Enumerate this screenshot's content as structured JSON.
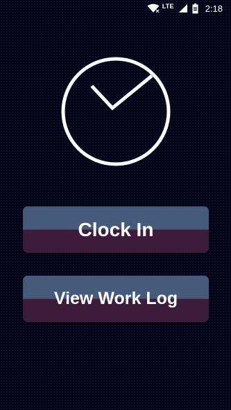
{
  "status_bar": {
    "network_label": "LTE",
    "time": "2:18",
    "icons": [
      "wifi-icon",
      "cellular-signal-icon",
      "battery-icon"
    ]
  },
  "main": {
    "clock_icon": "clock-icon",
    "clock_in_button": "Clock In",
    "view_work_log_button": "View Work Log"
  },
  "colors": {
    "background": "#05051a",
    "button_top": "#465a79",
    "button_bottom": "#3c1c3a",
    "foreground": "#ffffff"
  }
}
